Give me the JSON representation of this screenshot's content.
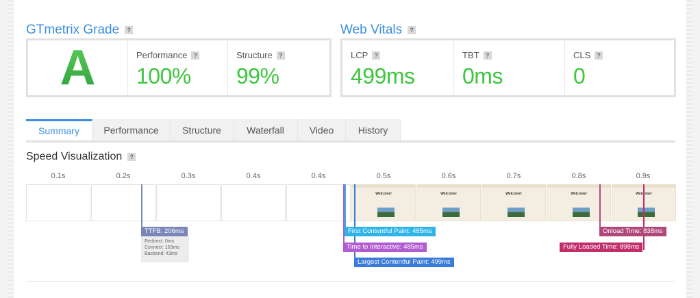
{
  "grade_section": {
    "title": "GTmetrix Grade",
    "grade": "A",
    "metrics": [
      {
        "label": "Performance",
        "value": "100%"
      },
      {
        "label": "Structure",
        "value": "99%"
      }
    ]
  },
  "vitals_section": {
    "title": "Web Vitals",
    "metrics": [
      {
        "label": "LCP",
        "value": "499ms"
      },
      {
        "label": "TBT",
        "value": "0ms"
      },
      {
        "label": "CLS",
        "value": "0"
      }
    ]
  },
  "help_glyph": "?",
  "tabs": [
    {
      "label": "Summary",
      "active": true
    },
    {
      "label": "Performance"
    },
    {
      "label": "Structure"
    },
    {
      "label": "Waterfall"
    },
    {
      "label": "Video"
    },
    {
      "label": "History"
    }
  ],
  "speed": {
    "title": "Speed Visualization",
    "ticks": [
      "0.1s",
      "0.2s",
      "0.3s",
      "0.4s",
      "0.4s",
      "0.5s",
      "0.6s",
      "0.7s",
      "0.8s",
      "0.9s"
    ],
    "frame_text": "Welcome!",
    "markers": {
      "ttfb": {
        "label": "TTFB: 206ms",
        "color": "#7a86b8"
      },
      "fcp": {
        "label": "First Contentful Paint: 485ms",
        "color": "#2fb4e8"
      },
      "tti": {
        "label": "Time to Interactive: 485ms",
        "color": "#b25cd1"
      },
      "lcp": {
        "label": "Largest Contentful Paint: 499ms",
        "color": "#3a7ad8"
      },
      "onload": {
        "label": "Onload Time: 838ms",
        "color": "#b0477a"
      },
      "fully_loaded": {
        "label": "Fully Loaded Time: 898ms",
        "color": "#c02f6a"
      }
    },
    "ttfb_breakdown": [
      "Redirect: 0ms",
      "Connect: 163ms",
      "Backend: 43ms"
    ]
  }
}
